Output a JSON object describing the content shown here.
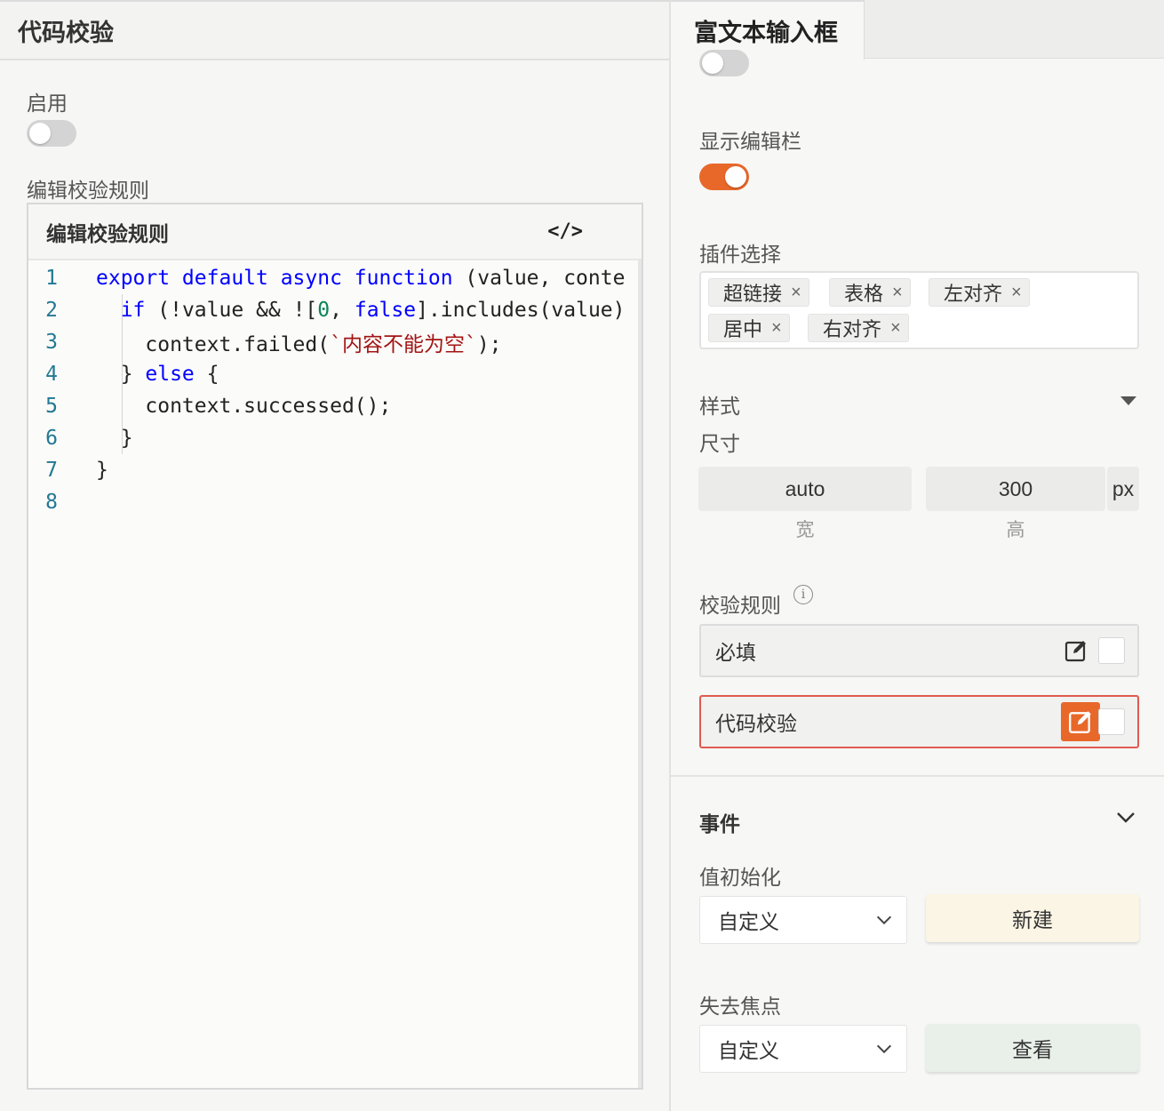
{
  "left": {
    "title": "代码校验",
    "enable_label": "启用",
    "enable_on": false,
    "rule_label": "编辑校验规则",
    "editor": {
      "title": "编辑校验规则",
      "code_icon": "</>",
      "line_numbers": [
        "1",
        "2",
        "3",
        "4",
        "5",
        "6",
        "7",
        "8"
      ]
    }
  },
  "code_lines": [
    [
      {
        "t": "export default async function",
        "c": "kw"
      },
      {
        "t": " (value, conte",
        "c": ""
      }
    ],
    [
      {
        "t": "  ",
        "c": ""
      },
      {
        "t": "if",
        "c": "kw"
      },
      {
        "t": " (!value && ![",
        "c": ""
      },
      {
        "t": "0",
        "c": "num"
      },
      {
        "t": ", ",
        "c": ""
      },
      {
        "t": "false",
        "c": "kw"
      },
      {
        "t": "].includes(value)",
        "c": ""
      }
    ],
    [
      {
        "t": "    context.failed(",
        "c": ""
      },
      {
        "t": "`内容不能为空`",
        "c": "str"
      },
      {
        "t": ");",
        "c": ""
      }
    ],
    [
      {
        "t": "  } ",
        "c": ""
      },
      {
        "t": "else",
        "c": "kw"
      },
      {
        "t": " {",
        "c": ""
      }
    ],
    [
      {
        "t": "    context.successed();",
        "c": ""
      }
    ],
    [
      {
        "t": "  }",
        "c": ""
      }
    ],
    [
      {
        "t": "}",
        "c": ""
      }
    ],
    [
      {
        "t": "",
        "c": ""
      }
    ]
  ],
  "right": {
    "tab_title": "富文本输入框",
    "show_toolbar_label": "显示编辑栏",
    "show_toolbar_on": true,
    "plugins_label": "插件选择",
    "plugins": [
      "超链接",
      "表格",
      "左对齐",
      "居中",
      "右对齐"
    ],
    "tag_remove": "×",
    "style_label": "样式",
    "size_label": "尺寸",
    "width_value": "auto",
    "height_value": "300",
    "unit": "px",
    "width_caption": "宽",
    "height_caption": "高",
    "validation_label": "校验规则",
    "info_glyph": "i",
    "rules": [
      "必填",
      "代码校验"
    ],
    "events_title": "事件",
    "init_label": "值初始化",
    "init_select": "自定义",
    "init_button": "新建",
    "blur_label": "失去焦点",
    "blur_select": "自定义",
    "blur_button": "查看"
  },
  "colors": {
    "accent": "#e8682a",
    "error_border": "#e05a4e",
    "new_button_bg": "#faf5e4",
    "view_button_bg": "#e9efe9"
  },
  "icons": [
    "code-icon",
    "close-icon",
    "caret-down-icon",
    "info-icon",
    "edit-icon",
    "chevron-down-icon"
  ]
}
